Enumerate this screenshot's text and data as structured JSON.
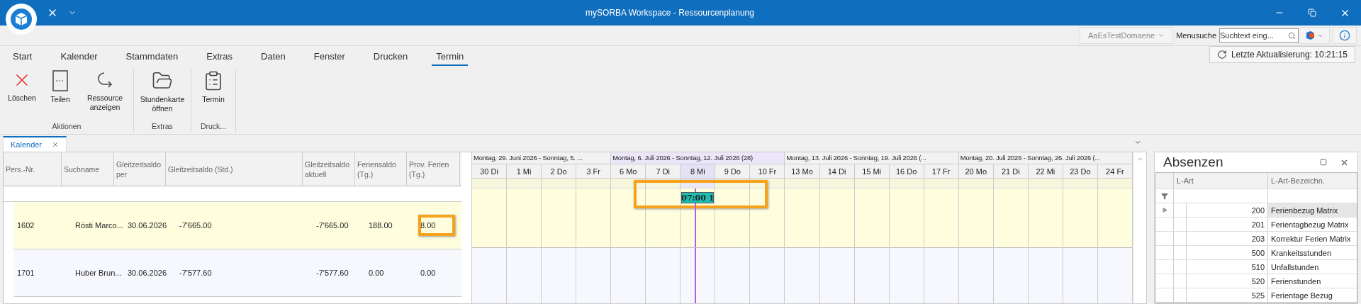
{
  "window": {
    "title": "mySORBA Workspace - Ressourcenplanung"
  },
  "top_toolbar": {
    "domain": "AaEsTestDomaene",
    "search_label": "Menusuche",
    "search_placeholder": "Suchtext eing..."
  },
  "ribbon": {
    "tabs": [
      {
        "label": "Start",
        "selected": false
      },
      {
        "label": "Kalender",
        "selected": false
      },
      {
        "label": "Stammdaten",
        "selected": false
      },
      {
        "label": "Extras",
        "selected": false
      },
      {
        "label": "Daten",
        "selected": false
      },
      {
        "label": "Fenster",
        "selected": false
      },
      {
        "label": "Drucken",
        "selected": false
      },
      {
        "label": "Termin",
        "selected": true
      }
    ],
    "groups": [
      {
        "label": "Aktionen",
        "buttons": [
          {
            "label": "Löschen",
            "kind": "delete"
          },
          {
            "label": "Teilen",
            "kind": "split"
          },
          {
            "label": "Ressource anzeigen",
            "kind": "redirect"
          }
        ]
      },
      {
        "label": "Extras",
        "buttons": [
          {
            "label": "Stundenkarte öffnen",
            "kind": "folder"
          }
        ]
      },
      {
        "label": "Druck...",
        "buttons": [
          {
            "label": "Termin",
            "kind": "clipboard"
          }
        ]
      }
    ],
    "refresh": "Letzte Aktualisierung: 10:21:15"
  },
  "document_tabs": [
    {
      "label": "Kalender",
      "selected": true
    }
  ],
  "grid": {
    "columns": [
      "Pers.-Nr.",
      "Suchname",
      "Gleitzeitsaldo per",
      "Gleitzeitsaldo (Std.)",
      "Gleitzeitsaldo aktuell",
      "Feriensaldo (Tg.)",
      "Prov. Ferien (Tg.)"
    ],
    "rows": [
      {
        "selected": true,
        "cells": [
          {
            "text": "1602",
            "highlighted": false
          },
          {
            "text": "Rösti Marco...",
            "highlighted": false
          },
          {
            "text": "30.06.2026",
            "highlighted": false
          },
          {
            "text": "-7'665.00",
            "highlighted": false
          },
          {
            "text": "-7'665.00",
            "highlighted": false
          },
          {
            "text": "188.00",
            "highlighted": false
          },
          {
            "text": "8.00",
            "highlighted": true
          }
        ]
      },
      {
        "selected": false,
        "cells": [
          {
            "text": "1701",
            "highlighted": false
          },
          {
            "text": "Huber Brun...",
            "highlighted": false
          },
          {
            "text": "30.06.2026",
            "highlighted": false
          },
          {
            "text": "-7'577.60",
            "highlighted": false
          },
          {
            "text": "-7'577.60",
            "highlighted": false
          },
          {
            "text": "0.00",
            "highlighted": false
          },
          {
            "text": "0.00",
            "highlighted": false
          }
        ]
      }
    ]
  },
  "scheduler": {
    "weeks": [
      {
        "label": "Montag, 29. Juni 2026 - Sonntag, 5. ...",
        "selected": false,
        "days": [
          {
            "label": "30 Di",
            "selected": false
          },
          {
            "label": "1 Mi",
            "selected": false
          },
          {
            "label": "2 Do",
            "selected": false
          },
          {
            "label": "3 Fr",
            "selected": false
          }
        ]
      },
      {
        "label": "Montag, 6. Juli 2026 - Sonntag, 12. Juli 2026 (28)",
        "selected": true,
        "days": [
          {
            "label": "6 Mo",
            "selected": false
          },
          {
            "label": "7 Di",
            "selected": false
          },
          {
            "label": "8 Mi",
            "selected": true,
            "appointment": {
              "label": "07:00 1",
              "highlighted": true
            }
          },
          {
            "label": "9 Do",
            "selected": false
          },
          {
            "label": "10 Fr",
            "selected": false
          }
        ]
      },
      {
        "label": "Montag, 13. Juli 2026 - Sonntag, 19. Juli 2026 (...",
        "selected": false,
        "days": [
          {
            "label": "13 Mo",
            "selected": false
          },
          {
            "label": "14 Di",
            "selected": false
          },
          {
            "label": "15 Mi",
            "selected": false
          },
          {
            "label": "16 Do",
            "selected": false
          },
          {
            "label": "17 Fr",
            "selected": false
          }
        ]
      },
      {
        "label": "Montag, 20. Juli 2026 - Sonntag, 26. Juli 2026 (...",
        "selected": false,
        "days": [
          {
            "label": "20 Mo",
            "selected": false
          },
          {
            "label": "21 Di",
            "selected": false
          },
          {
            "label": "22 Mi",
            "selected": false
          },
          {
            "label": "23 Do",
            "selected": false
          },
          {
            "label": "24 Fr",
            "selected": false
          }
        ]
      }
    ]
  },
  "absences": {
    "title": "Absenzen",
    "columns": [
      "L-Art",
      "L-Art-Bezeichn."
    ],
    "rows": [
      {
        "code": "200",
        "name": "Ferienbezug Matrix",
        "selected": true
      },
      {
        "code": "201",
        "name": "Ferientagbezug Matrix",
        "selected": false
      },
      {
        "code": "203",
        "name": "Korrektur Ferien Matrix",
        "selected": false
      },
      {
        "code": "500",
        "name": "Krankeitsstunden",
        "selected": false
      },
      {
        "code": "510",
        "name": "Unfallstunden",
        "selected": false
      },
      {
        "code": "520",
        "name": "Ferienstunden",
        "selected": false
      },
      {
        "code": "525",
        "name": "Ferientage Bezug",
        "selected": false
      }
    ]
  }
}
